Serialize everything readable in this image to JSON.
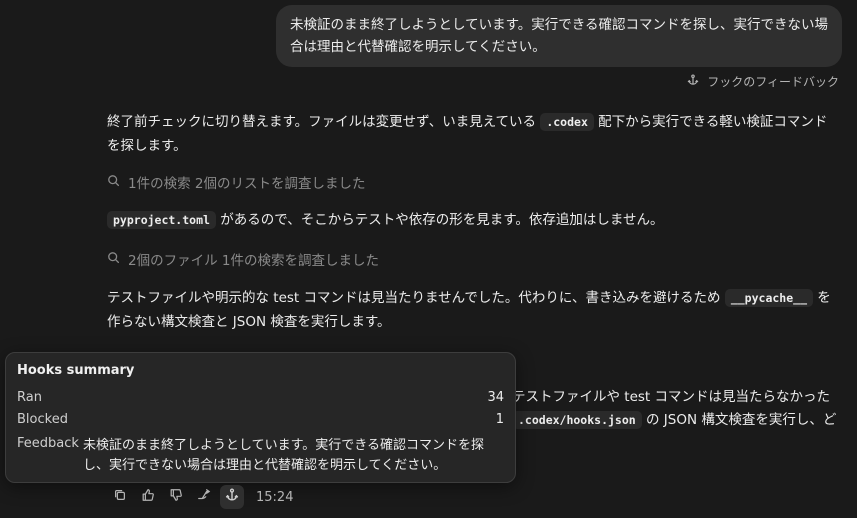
{
  "user_message": "未検証のまま終了しようとしています。実行できる確認コマンドを探し、実行できない場合は理由と代替確認を明示してください。",
  "feedback_link": "フックのフィードバック",
  "msg1": {
    "before": "終了前チェックに切り替えます。ファイルは変更せず、いま見えている",
    "code": ".codex",
    "after": "配下から実行できる軽い検証コマンドを探します。"
  },
  "search1": "1件の検索 2個のリストを調査しました",
  "msg2": {
    "code": "pyproject.toml",
    "after": "があるので、そこからテストや依存の形を見ます。依存追加はしません。"
  },
  "search2": "2個のファイル 1件の検索を調査しました",
  "msg3": {
    "before": "テストファイルや明示的な test コマンドは見当たりませんでした。代わりに、書き込みを避けるため",
    "code": "__pycache__",
    "after": "を作らない構文検査と JSON 検査を実行します。"
  },
  "msg4": {
    "line1": "テストファイルや test コマンドは見当たらなかった",
    "code": ".codex/hooks.json",
    "line2_after": "の JSON 構文検査を実行し、ど"
  },
  "hooks_summary": {
    "title": "Hooks summary",
    "ran_label": "Ran",
    "ran_value": "34",
    "blocked_label": "Blocked",
    "blocked_value": "1",
    "feedback_label": "Feedback",
    "feedback_text": "未検証のまま終了しようとしています。実行できる確認コマンドを探し、実行できない場合は理由と代替確認を明示してください。"
  },
  "actions": {
    "time": "15:24",
    "icons": [
      "copy-icon",
      "thumbs-up-icon",
      "thumbs-down-icon",
      "branch-icon",
      "hook-icon"
    ]
  }
}
